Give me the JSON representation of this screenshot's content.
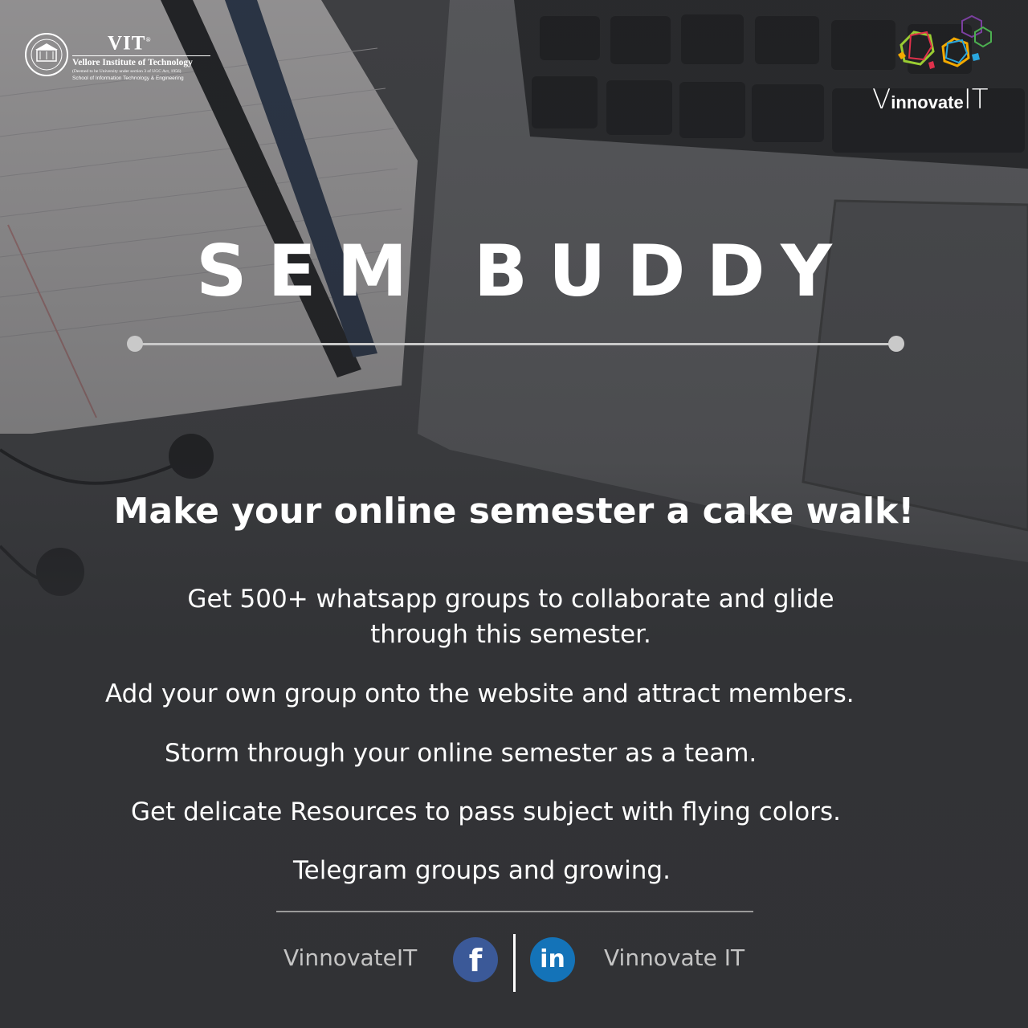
{
  "header": {
    "vit_name": "VIT",
    "vit_registered": "®",
    "vit_full_name": "Vellore Institute of Technology",
    "vit_deemed": "(Deemed to be University under section 3 of UGC Act, 1956)",
    "vit_school": "School of Information Technology & Engineering",
    "vinnovate_v": "V",
    "vinnovate_mid": "innovate",
    "vinnovate_it": "IT"
  },
  "title": "SEM BUDDY",
  "tagline": "Make your online semester a cake walk!",
  "features": {
    "line1a": "Get 500+ whatsapp groups to collaborate and glide",
    "line1b": "through this semester.",
    "line2": "Add your own group onto the website and attract members.",
    "line3": "Storm through your online semester as a team.",
    "line4": "Get delicate Resources to pass subject with flying colors.",
    "line5": "Telegram groups and growing."
  },
  "footer": {
    "left_handle": "VinnovateIT",
    "right_handle": "Vinnovate IT",
    "facebook_glyph": "f",
    "linkedin_glyph": "in"
  },
  "colors": {
    "facebook": "#3b5998",
    "linkedin": "#1473b8",
    "background": "#3a3b3d"
  }
}
